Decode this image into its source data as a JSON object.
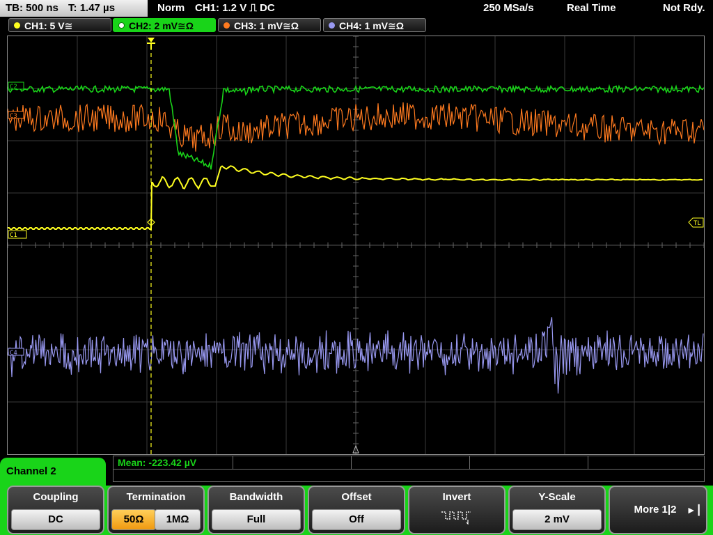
{
  "header": {
    "timebase": "TB: 500 ns",
    "trigger_time": "T: 1.47 µs",
    "mode": "Norm",
    "trigger_source": "CH1: 1.2 V ⎍ DC",
    "sample_rate": "250 MSa/s",
    "acquisition": "Real Time",
    "status": "Not Rdy."
  },
  "channel_tabs": [
    {
      "label": "CH1: 5 V≅",
      "color": "#ffff20"
    },
    {
      "label": "CH2: 2 mV≅Ω",
      "color": "#19d419"
    },
    {
      "label": "CH3: 1 mV≅Ω",
      "color": "#ff7a1f"
    },
    {
      "label": "CH4: 1 mV≅Ω",
      "color": "#9898f0"
    }
  ],
  "markers": {
    "ch1": "C1",
    "ch2": "C2",
    "ch3": "C3",
    "ch4": "C4",
    "trigger_level": "TL"
  },
  "channel_menu": {
    "title": "Channel 2",
    "measurement": "Mean: -223.42 µV"
  },
  "softkeys": {
    "coupling": {
      "label": "Coupling",
      "value": "DC"
    },
    "termination": {
      "label": "Termination",
      "value_50": "50Ω",
      "value_1m": "1MΩ"
    },
    "bandwidth": {
      "label": "Bandwidth",
      "value": "Full"
    },
    "offset": {
      "label": "Offset",
      "value": "Off"
    },
    "invert": {
      "label": "Invert"
    },
    "y_scale": {
      "label": "Y-Scale",
      "value": "2 mV"
    },
    "more": {
      "label": "More 1|2"
    }
  },
  "icons": {
    "invert": "invert-waveform-icon",
    "more": "right-arrow-icon"
  }
}
